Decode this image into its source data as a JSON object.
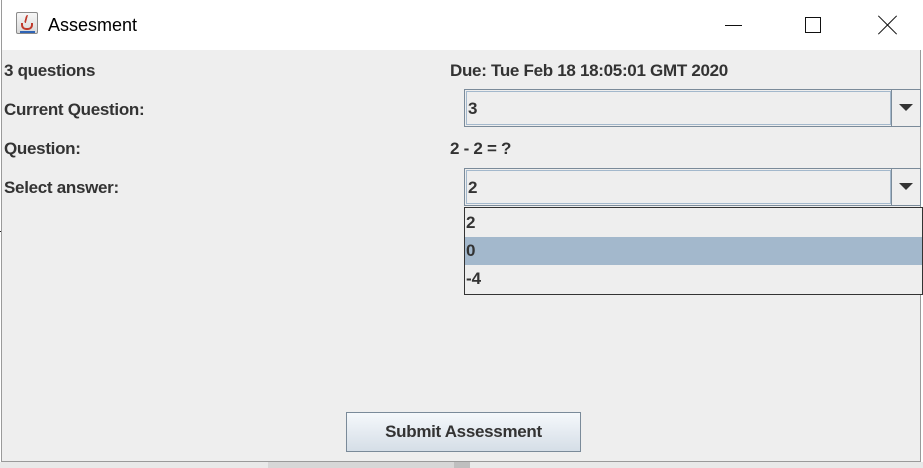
{
  "window": {
    "title": "Assesment",
    "icon": "java-cup-icon"
  },
  "form": {
    "question_count": "3 questions",
    "due": "Due: Tue Feb 18 18:05:01 GMT 2020",
    "current_question_label": "Current Question:",
    "current_question_value": "3",
    "question_label": "Question:",
    "question_text": "2 - 2 = ?",
    "select_answer_label": "Select answer:",
    "selected_answer": "2",
    "answer_options": [
      "2",
      "0",
      "-4"
    ],
    "highlighted_option": "0"
  },
  "actions": {
    "submit_label": "Submit Assessment"
  },
  "colors": {
    "panel_bg": "#eeeeee",
    "highlight": "#a3b8cc",
    "text": "#333333"
  }
}
